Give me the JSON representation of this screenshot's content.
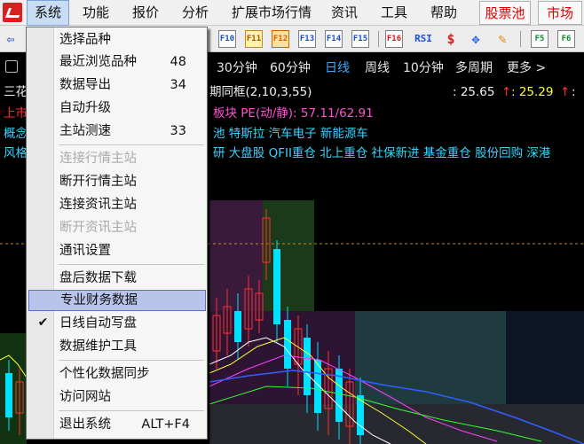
{
  "menubar": {
    "items": [
      "系统",
      "功能",
      "报价",
      "分析",
      "扩展市场行情",
      "资讯",
      "工具",
      "帮助"
    ],
    "red_items": [
      "股票池",
      "市场"
    ]
  },
  "toolbar": {
    "left_icon": "⇦",
    "buttons_right": [
      "F10",
      "F11",
      "F12",
      "F13",
      "F14",
      "F15",
      "F16",
      "RSI",
      "$",
      "✥",
      "✎",
      "F5",
      "F6"
    ]
  },
  "periodbar": {
    "items": [
      "30分钟",
      "60分钟",
      "日线",
      "周线",
      "10分钟",
      "多周期",
      "更多 >"
    ],
    "active": "日线"
  },
  "info": {
    "stock_prefix": "三花",
    "indicator": "期同框(2,10,3,55)",
    "value1": ": 25.65",
    "value2": ": 25.29",
    "line2_prefix": "上市",
    "line2_pe": "板块 PE(动/静): 57.11/62.91",
    "line3_prefix": "概念",
    "line3_text": "池 特斯拉 汽车电子 新能源车",
    "line4_prefix": "风格",
    "line4_text": "研 大盘股 QFII重仓 北上重仓 社保新进 基金重仓 股份回购 深港"
  },
  "dropdown": {
    "items": [
      {
        "label": "选择品种",
        "shortcut": "",
        "state": "normal"
      },
      {
        "label": "最近浏览品种",
        "shortcut": "48",
        "state": "normal"
      },
      {
        "label": "数据导出",
        "shortcut": "34",
        "state": "normal"
      },
      {
        "label": "自动升级",
        "shortcut": "",
        "state": "normal"
      },
      {
        "label": "主站测速",
        "shortcut": "33",
        "state": "normal"
      },
      {
        "label": "连接行情主站",
        "shortcut": "",
        "state": "disabled"
      },
      {
        "label": "断开行情主站",
        "shortcut": "",
        "state": "normal"
      },
      {
        "label": "连接资讯主站",
        "shortcut": "",
        "state": "normal"
      },
      {
        "label": "断开资讯主站",
        "shortcut": "",
        "state": "disabled"
      },
      {
        "label": "通讯设置",
        "shortcut": "",
        "state": "normal"
      },
      {
        "label": "盘后数据下载",
        "shortcut": "",
        "state": "normal"
      },
      {
        "label": "专业财务数据",
        "shortcut": "",
        "state": "highlight"
      },
      {
        "label": "日线自动写盘",
        "shortcut": "",
        "state": "checked"
      },
      {
        "label": "数据维护工具",
        "shortcut": "",
        "state": "normal"
      },
      {
        "label": "个性化数据同步",
        "shortcut": "",
        "state": "normal"
      },
      {
        "label": "访问网站",
        "shortcut": "",
        "state": "normal"
      },
      {
        "label": "退出系统",
        "shortcut": "ALT+F4",
        "state": "normal"
      }
    ]
  },
  "colors": {
    "menubar_bg": "#f0f0f0",
    "menu_red": "#e00000",
    "chart_bg": "#000000",
    "highlight_bg": "#b8c4ea",
    "text_cyan": "#39d3ff",
    "text_magenta": "#ff4fd0"
  }
}
